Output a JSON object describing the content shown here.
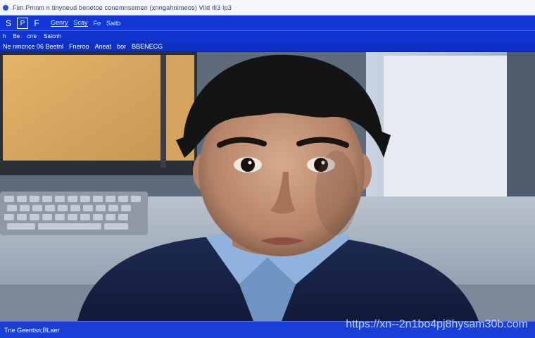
{
  "window": {
    "title": "Fim Pmnm n tinyneud benetoe conemnsemen (xnngahnimeos) Vild ifi3 Ip3"
  },
  "menubar": {
    "btn1": "S",
    "btn2": "P",
    "btn3": "F",
    "items": [
      "Genry",
      "Scay",
      "Fo",
      "Saitb"
    ]
  },
  "toolbar": {
    "items": [
      "h",
      "Be",
      "crre",
      "Satcnh"
    ]
  },
  "addressbar": {
    "items": [
      "Ne nmcnce 06 Beetnl",
      "Fneroo",
      "Aneat",
      "bor",
      "BBENECG"
    ]
  },
  "statusbar": {
    "text": "Tne Geentsn;BLaer"
  },
  "watermark": {
    "text": "https://xn--2n1bo4pj8hysam30b.com"
  },
  "colors": {
    "accent": "#1237d6",
    "statusbar": "#1a3fd8",
    "titlebar": "#f4f6fb"
  }
}
